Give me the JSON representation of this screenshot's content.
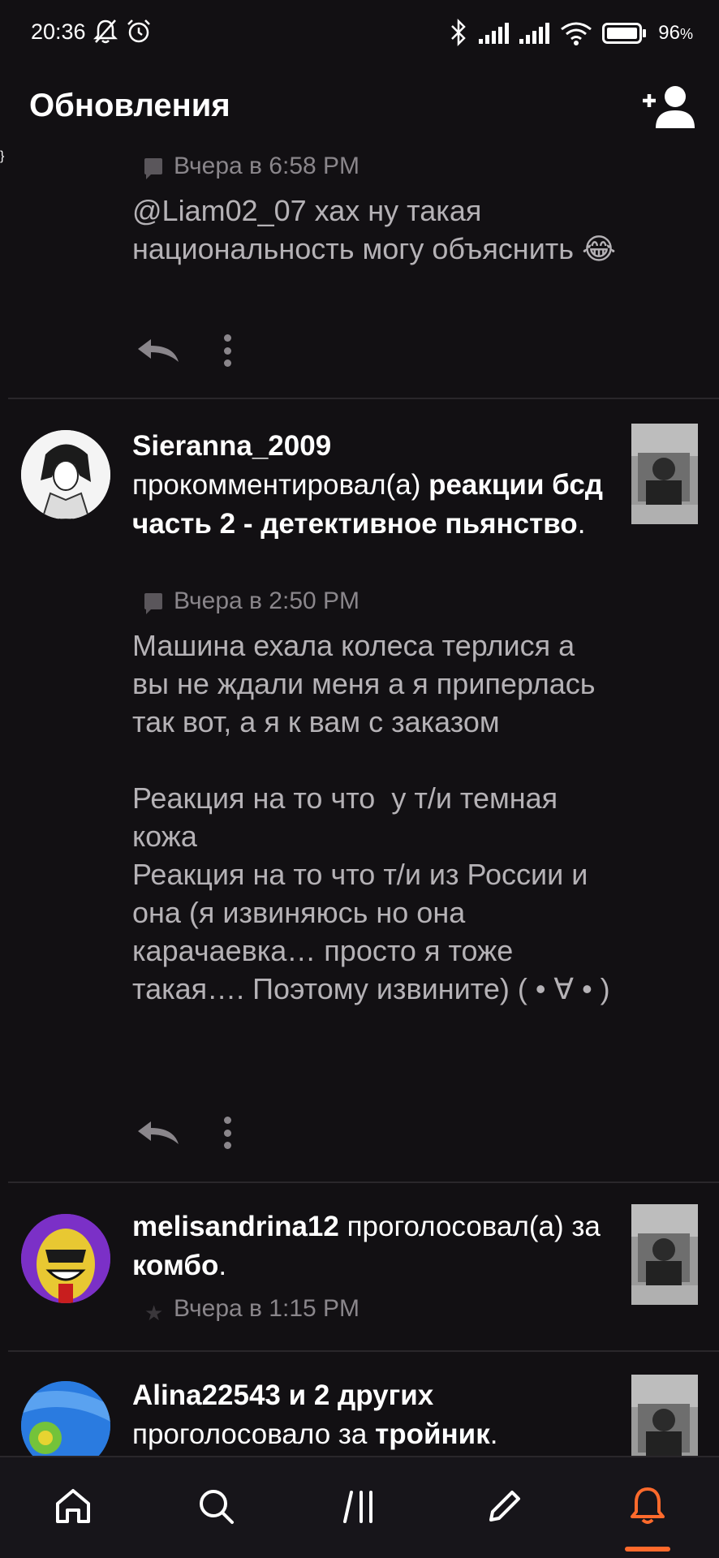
{
  "status_bar": {
    "time": "20:36",
    "battery_pct": "96",
    "icons": [
      "muted-bell-icon",
      "alarm-icon",
      "bluetooth-icon",
      "signal-icon",
      "signal-icon",
      "wifi-icon",
      "battery-icon"
    ]
  },
  "header": {
    "title": "Обновления",
    "action_icon": "add-user-icon"
  },
  "feed": {
    "items": [
      {
        "meta": "Вчера в 6:58 PM",
        "meta_icon": "comment-icon",
        "text": "@Liam02_07 хах ну такая национальность могу объяснить 😂"
      },
      {
        "user": "Sieranna_2009",
        "action": " прокомментировал(а) ",
        "target": "реакции бсд часть 2 - детективное пьянство",
        "suffix": ".",
        "meta": "Вчера в 2:50 PM",
        "meta_icon": "comment-icon",
        "text": "Машина ехала колеса терлися а вы не ждали меня а я приперлась так вот, а я к вам с заказом\n\nРеакция на то что  у т/и темная кожа\nРеакция на то что т/и из России и она (я извиняюсь но она карачаевка… просто я тоже такая…. Поэтому извините) ( • ∀ • )"
      },
      {
        "user": "melisandrina12",
        "action": " проголосовал(а) за ",
        "target": "комбо",
        "suffix": ".",
        "meta": "Вчера в 1:15 PM",
        "meta_icon": "star-icon"
      },
      {
        "user": "Alina22543 и 2 других",
        "action": " проголосовало за ",
        "target": "тройник",
        "suffix": "."
      }
    ]
  },
  "bottom_nav": {
    "items": [
      "home-icon",
      "search-icon",
      "library-icon",
      "write-icon",
      "notifications-icon"
    ],
    "active": "notifications-icon",
    "accent": "#ff6a2c"
  }
}
